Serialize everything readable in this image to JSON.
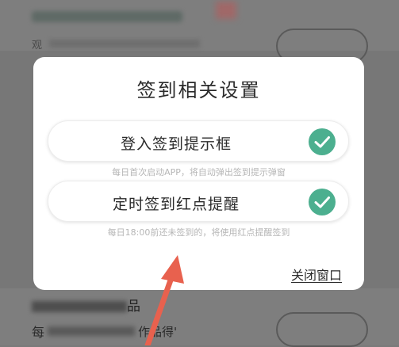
{
  "background": {
    "sub_label": "观",
    "section_char": "品",
    "row_char": "每",
    "row_text": "作品得'"
  },
  "modal": {
    "title": "签到相关设置",
    "options": [
      {
        "label": "登入签到提示框",
        "description": "每日首次启动APP，将自动弹出签到提示弹窗",
        "checked": true
      },
      {
        "label": "定时签到红点提醒",
        "description": "每日18:00前还未签到的，将使用红点提醒签到",
        "checked": true
      }
    ],
    "close_label": "关闭窗口"
  },
  "colors": {
    "accent": "#4caf8f",
    "arrow": "#e8614e",
    "overlay": "#777777"
  },
  "icons": {
    "option_check": "check-circle-icon"
  }
}
